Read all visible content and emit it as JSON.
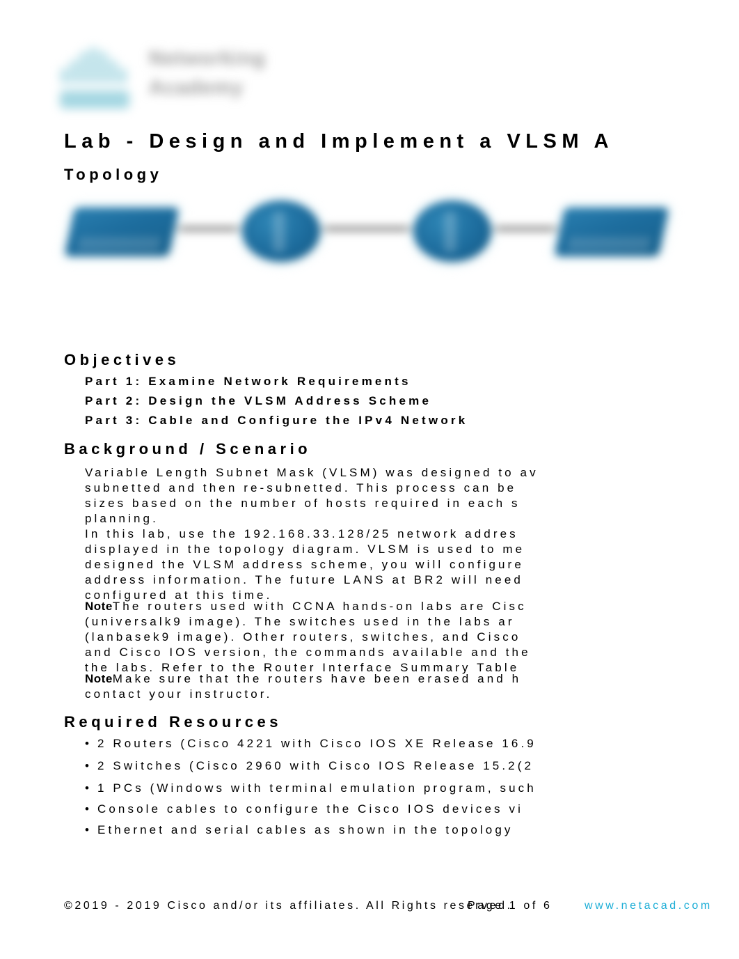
{
  "document": {
    "title": "Lab - Design and Implement a VLSM A"
  },
  "logo": {
    "line1": "Networking",
    "line2": "Academy",
    "bridge_color": "#a5d7e2",
    "text_color": "#9a9a9a"
  },
  "sections": {
    "topology_heading": "Topology",
    "objectives_heading": "Objectives",
    "background_heading": "Background / Scenario",
    "resources_heading": "Required Resources"
  },
  "topology": {
    "nodes": [
      {
        "name": "switch-left",
        "type": "switch",
        "label": ""
      },
      {
        "name": "router-left",
        "type": "router",
        "label": ""
      },
      {
        "name": "router-right",
        "type": "router",
        "label": ""
      },
      {
        "name": "switch-right",
        "type": "switch",
        "label": ""
      }
    ],
    "labels": {
      "left": "",
      "center": "",
      "right_line1": "",
      "right_line2": "",
      "right_line3": "",
      "right_line4": ""
    }
  },
  "objectives": [
    "Part 1: Examine Network Requirements",
    "Part 2: Design the VLSM Address Scheme",
    "Part 3: Cable and Configure the IPv4 Network"
  ],
  "background": {
    "paragraph1": [
      "Variable Length Subnet Mask (VLSM) was designed to av",
      "subnetted and then re-subnetted. This process can be",
      "sizes based on the number of hosts required in each s",
      "planning."
    ],
    "paragraph2": [
      "In this lab, use the 192.168.33.128/25 network addres",
      "displayed in the topology diagram. VLSM is used to me",
      "designed the VLSM address scheme, you will configure",
      "address information. The future LANS at BR2 will need",
      "configured at this time."
    ],
    "note1_label": "Note",
    "note1": [
      "The routers used with CCNA hands-on labs are Cisc",
      "(universalk9 image). The switches used in the labs ar",
      "(lanbasek9 image). Other routers, switches, and Cisco",
      "and Cisco IOS version, the commands available and the",
      "the labs. Refer to the Router Interface Summary Table"
    ],
    "note2_label": "Note",
    "note2": [
      "Make sure that the routers have been erased and h",
      "contact your instructor."
    ]
  },
  "required_resources": {
    "bullet_glyph": "•",
    "items": [
      "2 Routers (Cisco 4221 with Cisco IOS XE Release 16.9",
      "2 Switches (Cisco 2960 with Cisco IOS Release 15.2(2",
      "1 PCs (Windows with terminal emulation program, such",
      "Console cables to configure the Cisco IOS devices vi",
      "Ethernet and serial cables as shown in the topology"
    ]
  },
  "footer": {
    "copyright": "©2019 - 2019 Cisco and/or its affiliates. All Rights reserved.",
    "page": "Page 1 of 6",
    "link": "www.netacad.com",
    "link_color": "#1badd6"
  }
}
